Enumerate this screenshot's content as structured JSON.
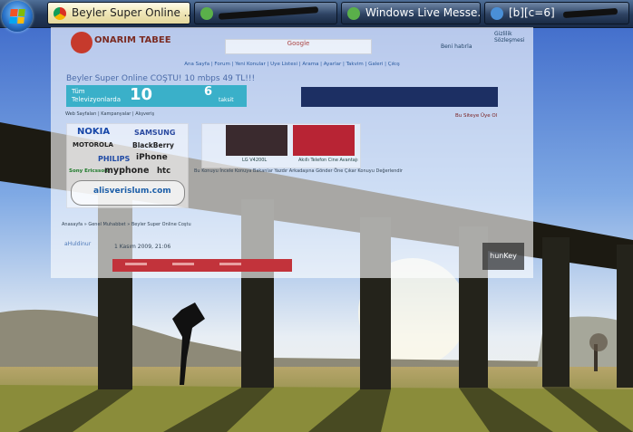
{
  "taskbar": {
    "tasks": [
      {
        "label": "Beyler Super Online ...",
        "active": true
      },
      {
        "label": "",
        "active": false
      },
      {
        "label": "Windows Live Messe...",
        "active": false
      },
      {
        "label": "[b][c=6]",
        "active": false
      }
    ]
  },
  "browser": {
    "logo_text": "ONARIM TABEE",
    "search_text": "Google",
    "gizlilik": "Gizlilik Sözleşmesi",
    "login_label": "Beni hatırla",
    "nav_links": "Ana Sayfa | Forum | Yeni Konular | Üye Listesi | Arama | Ayarlar | Takvim | Galeri | Çıkış",
    "headline": "Beyler Super Online COŞTU! 10 mbps 49 TL!!!",
    "promo": {
      "tv_text": "Tüm Televizyonlarda",
      "big_value": "10",
      "small_value": "6",
      "small_unit": "taksit"
    },
    "sub_links": "Web Sayfaları | Kampanyalar | Alışveriş",
    "right_link": "Bu Siteye Üye Ol",
    "brands": {
      "nokia": "NOKIA",
      "samsung": "SAMSUNG",
      "motorola": "MOTOROLA",
      "blackberry": "BlackBerry",
      "philips": "PHILIPS",
      "iphone": "iPhone",
      "sonyericsson": "Sony Ericsson",
      "myphone": "myphone",
      "htc": "htc",
      "alis": "alisverislum.com"
    },
    "lg": {
      "cap1": "LG V4200L",
      "cap2": "Akıllı Telefon Cine Avantajı"
    },
    "lorem": "Bu Konuyu İncele Konuya Bakanlar Yazdır Arkadaşına Gönder Öne Çıkar Konuyu Değerlendir",
    "crumb": "Anasayfa » Genel Muhabbet » Beyler Super Online Coştu",
    "user_name": "aHuldinur",
    "post_date": "1 Kasım 2009, 21:06",
    "hunkey": "hunKey"
  }
}
